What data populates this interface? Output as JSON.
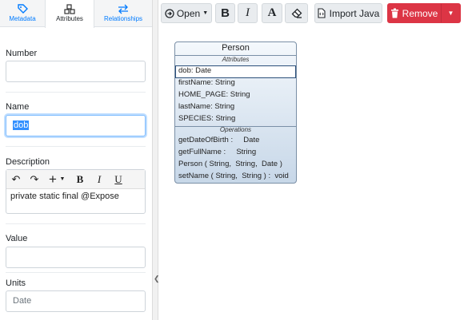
{
  "tabs": [
    {
      "label": "Metadata",
      "icon": "tag-icon",
      "active": false
    },
    {
      "label": "Attributes",
      "icon": "cubes-icon",
      "active": true
    },
    {
      "label": "Relationships",
      "icon": "arrows-exchange-icon",
      "active": false
    }
  ],
  "form": {
    "number_label": "Number",
    "number_value": "",
    "name_label": "Name",
    "name_value": "dob",
    "description_label": "Description",
    "description_text": "private static final @Expose",
    "value_label": "Value",
    "value_value": "",
    "units_label": "Units",
    "units_placeholder": "Date"
  },
  "editor_toolbar": {
    "undo": "↶",
    "redo": "↷",
    "insert": "+",
    "bold": "B",
    "italic": "I",
    "underline": "U"
  },
  "toolbar": {
    "open_label": "Open",
    "bold_label": "B",
    "italic_label": "I",
    "font_label": "A",
    "import_label": "Import Java",
    "remove_label": "Remove"
  },
  "uml": {
    "class_name": "Person",
    "attributes_header": "Attributes",
    "attributes": [
      "dob: Date",
      "firstName: String",
      "HOME_PAGE: String",
      "lastName: String",
      "SPECIES: String"
    ],
    "operations_header": "Operations",
    "operations": [
      "getDateOfBirth :     Date",
      "getFullName :     String",
      "Person ( String,  String,  Date )",
      "setName ( String,  String ) :  void"
    ]
  },
  "colors": {
    "accent": "#007bff",
    "danger": "#dc3545",
    "uml_border": "#7a8fa6"
  }
}
